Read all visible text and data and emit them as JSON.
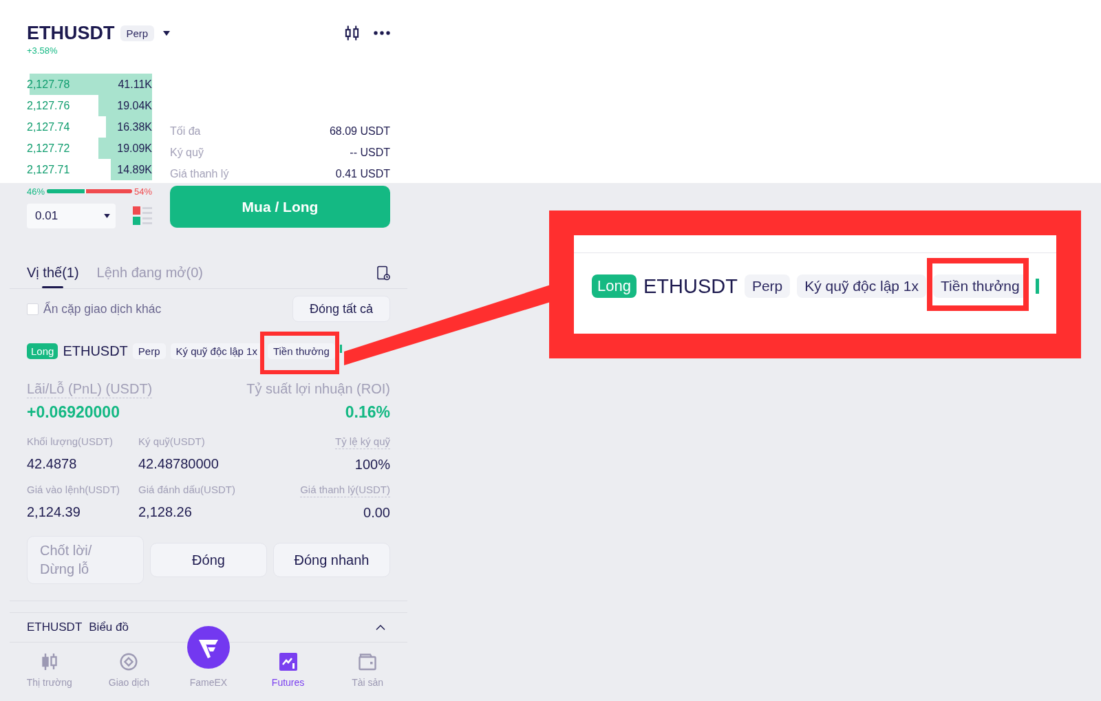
{
  "header": {
    "symbol": "ETHUSDT",
    "market_type": "Perp",
    "change": "+3.58%"
  },
  "order_book": {
    "rows": [
      {
        "price": "2,127.78",
        "amount": "41.11K",
        "level": 0.98
      },
      {
        "price": "2,127.76",
        "amount": "19.04K",
        "level": 0.43
      },
      {
        "price": "2,127.74",
        "amount": "16.38K",
        "level": 0.37
      },
      {
        "price": "2,127.72",
        "amount": "19.09K",
        "level": 0.43
      },
      {
        "price": "2,127.71",
        "amount": "14.89K",
        "level": 0.33
      }
    ]
  },
  "order_info": [
    {
      "label": "Tối đa",
      "value": "68.09 USDT"
    },
    {
      "label": "Ký quỹ",
      "value": "-- USDT"
    },
    {
      "label": "Giá thanh lý",
      "value": "0.41 USDT"
    }
  ],
  "ratio": {
    "buy": "46%",
    "sell": "54%",
    "level": 0.46
  },
  "quantity": {
    "value": "0.01"
  },
  "buy_button": "Mua / Long",
  "tabs": [
    {
      "label": "Vị thế(1)",
      "selected": true
    },
    {
      "label": "Lệnh đang mở(0)",
      "selected": false
    }
  ],
  "hide_other_pairs": {
    "label": "Ẩn cặp giao dịch khác",
    "checked": false
  },
  "close_all_button": "Đóng tất cả",
  "position": {
    "side": "Long",
    "symbol": "ETHUSDT",
    "tags": [
      {
        "label": "Perp",
        "highlighted": false
      },
      {
        "label": "Ký quỹ độc lập 1x",
        "highlighted": false
      },
      {
        "label": "Tiền thưởng",
        "highlighted": true
      }
    ],
    "pnl": {
      "label": "Lãi/Lỗ (PnL) (USDT)",
      "value": "+0.06920000",
      "underlined": true
    },
    "roi": {
      "label": "Tỷ suất lợi nhuận (ROI)",
      "value": "0.16%",
      "underlined": false
    },
    "stats": [
      {
        "label": "Khối lượng(USDT)",
        "value": "42.4878",
        "underlined": false
      },
      {
        "label": "Ký quỹ(USDT)",
        "value": "42.48780000",
        "underlined": false
      },
      {
        "label": "Tỷ lệ ký quỹ",
        "value": "100%",
        "underlined": true
      },
      {
        "label": "Giá vào lệnh(USDT)",
        "value": "2,124.39",
        "underlined": false
      },
      {
        "label": "Giá đánh dấu(USDT)",
        "value": "2,128.26",
        "underlined": false
      },
      {
        "label": "Giá thanh lý(USDT)",
        "value": "0.00",
        "underlined": true
      }
    ],
    "actions": [
      {
        "label": "Chốt lời/ Dừng lỗ",
        "disabled": true
      },
      {
        "label": "Đóng",
        "disabled": false
      },
      {
        "label": "Đóng nhanh",
        "disabled": false
      }
    ]
  },
  "chart_panel": {
    "symbol": "ETHUSDT",
    "label": "Biểu đồ",
    "expanded": true
  },
  "nav": [
    {
      "label": "Thị trường",
      "kind": "market",
      "selected": false
    },
    {
      "label": "Giao dịch",
      "kind": "trade",
      "selected": false
    },
    {
      "label": "FameEX",
      "kind": "home",
      "selected": false
    },
    {
      "label": "Futures",
      "kind": "futures",
      "selected": true
    },
    {
      "label": "Tài sản",
      "kind": "assets",
      "selected": false
    }
  ],
  "callout": {
    "side": "Long",
    "symbol": "ETHUSDT",
    "tags": [
      {
        "label": "Perp",
        "highlighted": false
      },
      {
        "label": "Ký quỹ độc lập 1x",
        "highlighted": false
      },
      {
        "label": "Tiền thưởng",
        "highlighted": true
      }
    ]
  }
}
